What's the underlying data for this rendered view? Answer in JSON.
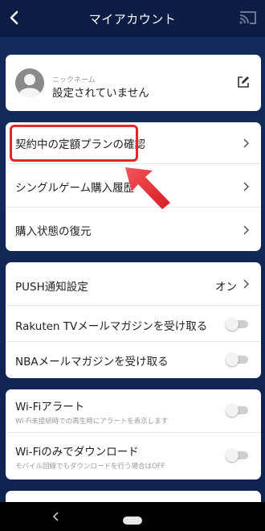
{
  "header": {
    "title": "マイアカウント",
    "back_icon": "chevron-left-icon",
    "cast_icon": "cast-icon"
  },
  "profile": {
    "nickname_caption": "ニックネーム",
    "nickname_value": "設定されていません",
    "avatar_icon": "avatar-icon",
    "edit_icon": "edit-icon"
  },
  "purchases": {
    "items": [
      {
        "label": "契約中の定額プランの確認",
        "highlighted": true
      },
      {
        "label": "シングルゲーム購入履歴"
      },
      {
        "label": "購入状態の復元"
      }
    ],
    "highlight_color": "#e8242c"
  },
  "notifications": {
    "push_label": "PUSH通知設定",
    "push_value": "オン",
    "rakuten_label": "Rakuten TVメールマガジンを受け取る",
    "rakuten_on": false,
    "nba_label": "NBAメールマガジンを受け取る",
    "nba_on": false
  },
  "network": {
    "wifi_alert_label": "Wi-Fiアラート",
    "wifi_alert_sub": "Wi-Fi未接続時での再生時にアラートを表示します",
    "wifi_alert_on": false,
    "wifi_dl_label": "Wi-Fiのみでダウンロード",
    "wifi_dl_sub": "モバイル回線でもダウンロードを行う場合はOFF",
    "wifi_dl_on": false
  },
  "navbar": {
    "back_icon": "nav-back-icon",
    "home_icon": "nav-home-pill-icon"
  },
  "colors": {
    "header_bg": "#0c1c44",
    "page_bg": "#132a5c",
    "card_bg": "#ffffff",
    "highlight": "#e8242c"
  }
}
